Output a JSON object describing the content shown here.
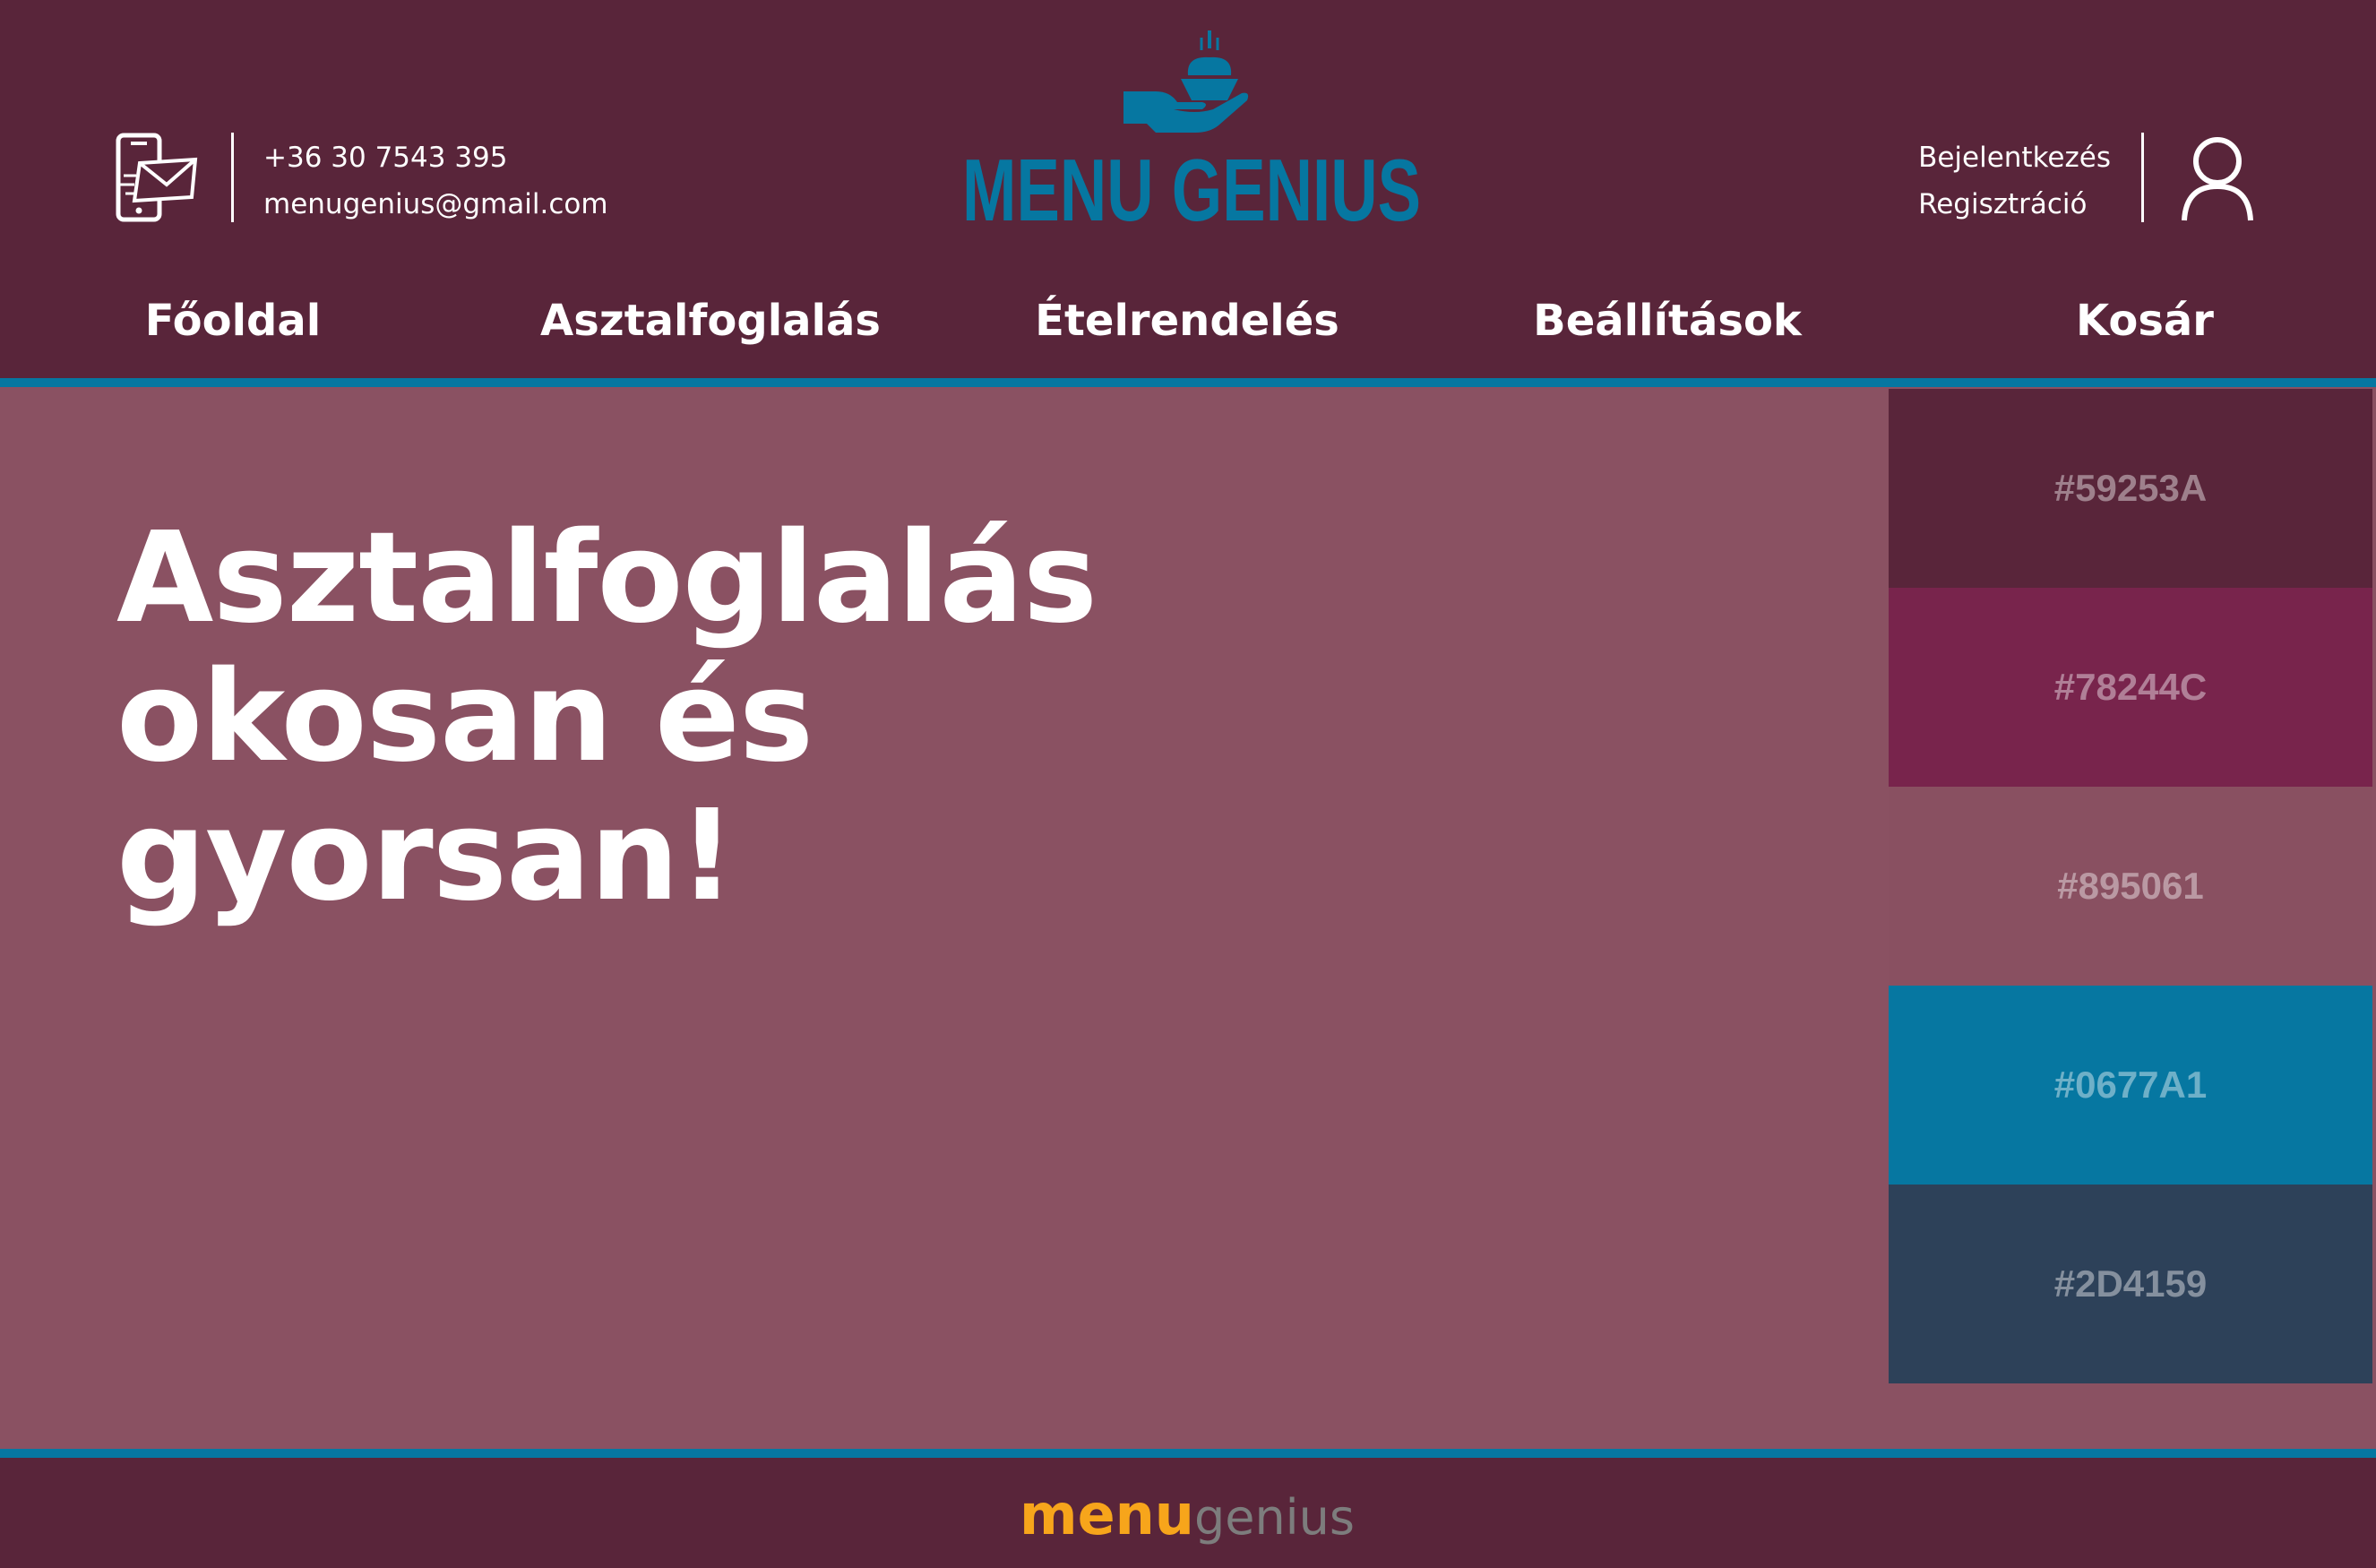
{
  "header": {
    "phone": "+36 30 7543 395",
    "email": "menugenius@gmail.com",
    "logo_text": "MENU GENIUS",
    "login": "Bejelentkezés",
    "register": "Regisztráció"
  },
  "nav": {
    "items": [
      "Főoldal",
      "Asztalfoglalás",
      "Ételrendelés",
      "Beállítások",
      "Kosár"
    ]
  },
  "hero": {
    "line1": "Asztalfoglalás",
    "line2": "okosan és",
    "line3": "gyorsan!"
  },
  "palette": {
    "swatches": [
      {
        "label": "#59253A",
        "color": "#59253A"
      },
      {
        "label": "#78244C",
        "color": "#78244C"
      },
      {
        "label": "#895061",
        "color": "#895061"
      },
      {
        "label": "#0677A1",
        "color": "#0677A1"
      },
      {
        "label": "#2D4159",
        "color": "#2D4159"
      }
    ]
  },
  "footer": {
    "logo_menu": "menu",
    "logo_genius": "genius"
  },
  "colors": {
    "header_bg": "#59253a",
    "accent": "#0677a1",
    "content_bg": "#8a5162",
    "footer_logo_orange": "#f7a51b"
  }
}
